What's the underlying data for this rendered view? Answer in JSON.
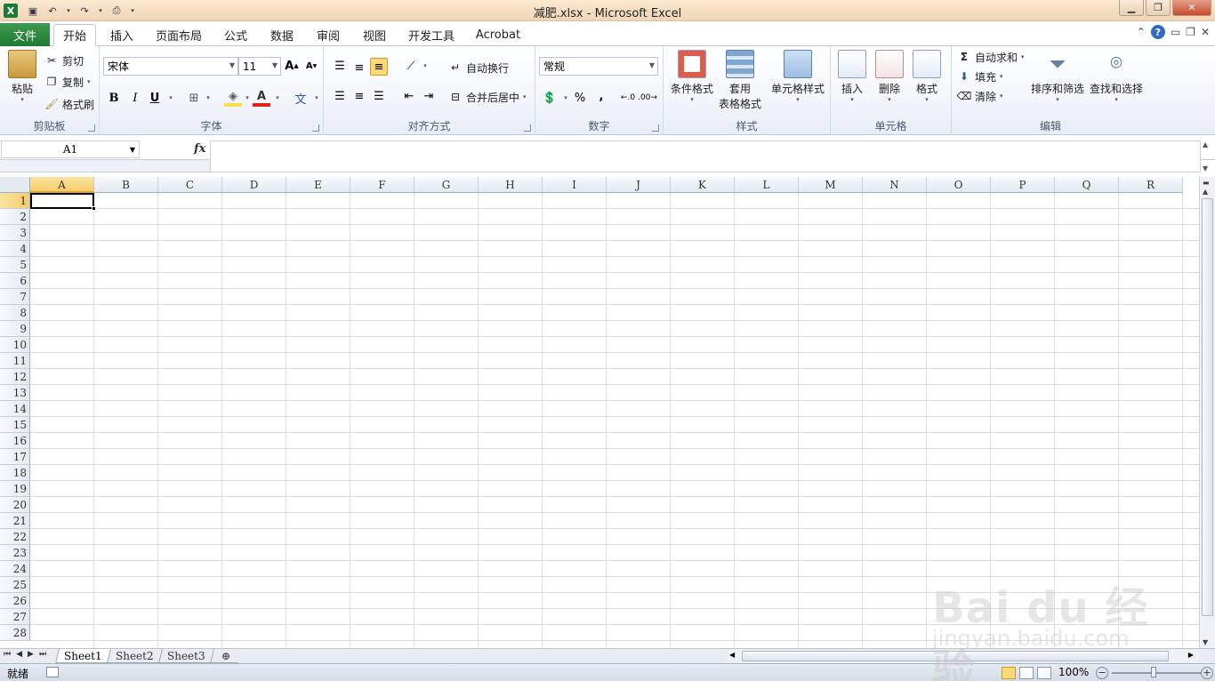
{
  "window": {
    "title": "减肥.xlsx - Microsoft Excel"
  },
  "tabs": {
    "file": "文件",
    "items": [
      "开始",
      "插入",
      "页面布局",
      "公式",
      "数据",
      "审阅",
      "视图",
      "开发工具",
      "Acrobat"
    ],
    "active": "开始"
  },
  "ribbon": {
    "clipboard": {
      "label": "剪贴板",
      "paste": "粘贴",
      "cut": "剪切",
      "copy": "复制",
      "format_painter": "格式刷"
    },
    "font": {
      "label": "字体",
      "font_name": "宋体",
      "font_size": "11",
      "bold": "B",
      "italic": "I",
      "underline": "U",
      "grow": "A",
      "shrink": "A",
      "font_color_glyph": "A",
      "phonetic": "文"
    },
    "alignment": {
      "label": "对齐方式",
      "wrap": "自动换行",
      "merge": "合并后居中"
    },
    "number": {
      "label": "数字",
      "format": "常规",
      "percent": "%",
      "comma": ","
    },
    "styles": {
      "label": "样式",
      "conditional": "条件格式",
      "table_line1": "套用",
      "table_line2": "表格格式",
      "cell_styles": "单元格样式"
    },
    "cells": {
      "label": "单元格",
      "insert": "插入",
      "delete": "删除",
      "format": "格式"
    },
    "editing": {
      "label": "编辑",
      "autosum": "自动求和",
      "fill": "填充",
      "clear": "清除",
      "sort_filter": "排序和筛选",
      "find_select": "查找和选择"
    }
  },
  "formula_bar": {
    "name_box": "A1",
    "fx": "fx",
    "content": ""
  },
  "grid": {
    "columns": [
      "A",
      "B",
      "C",
      "D",
      "E",
      "F",
      "G",
      "H",
      "I",
      "J",
      "K",
      "L",
      "M",
      "N",
      "O",
      "P",
      "Q",
      "R"
    ],
    "rows": [
      "1",
      "2",
      "3",
      "4",
      "5",
      "6",
      "7",
      "8",
      "9",
      "10",
      "11",
      "12",
      "13",
      "14",
      "15",
      "16",
      "17",
      "18",
      "19",
      "20",
      "21",
      "22",
      "23",
      "24",
      "25",
      "26",
      "27",
      "28"
    ],
    "active_cell": "A1"
  },
  "sheets": {
    "items": [
      "Sheet1",
      "Sheet2",
      "Sheet3"
    ],
    "active": "Sheet1"
  },
  "status": {
    "ready": "就绪",
    "zoom": "100%"
  },
  "watermark": {
    "brand": "Bai du 经验",
    "url": "jingyan.baidu.com"
  }
}
